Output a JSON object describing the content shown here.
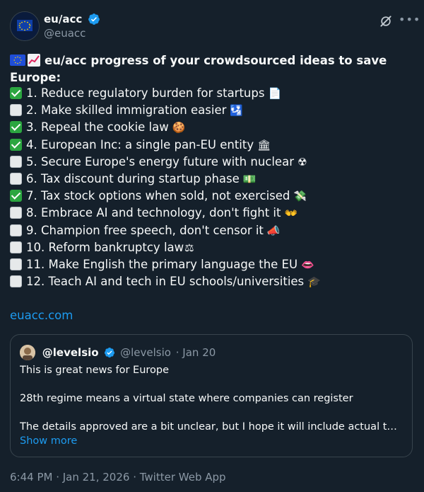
{
  "author": {
    "display_name": "eu/acc",
    "handle": "@euacc",
    "verified": true
  },
  "headline": "eu/acc progress of your crowdsourced ideas to save Europe:",
  "items": [
    {
      "text": "1. Reduce regulatory burden for startups",
      "done": true,
      "emoji": "📄"
    },
    {
      "text": "2. Make skilled immigration easier",
      "done": false,
      "emoji": "🛂"
    },
    {
      "text": "3. Repeal the cookie law",
      "done": true,
      "emoji": "🍪"
    },
    {
      "text": "4. European Inc: a single pan-EU entity",
      "done": true,
      "emoji": "🏛"
    },
    {
      "text": "5. Secure Europe's energy future with nuclear",
      "done": false,
      "emoji": "☢"
    },
    {
      "text": "6. Tax discount during startup phase",
      "done": false,
      "emoji": "💵"
    },
    {
      "text": "7. Tax stock options when sold, not exercised",
      "done": true,
      "emoji": "💸"
    },
    {
      "text": "8. Embrace AI and technology, don't fight it",
      "done": false,
      "emoji": "👐"
    },
    {
      "text": "9. Champion free speech, don't censor it",
      "done": false,
      "emoji": "📣"
    },
    {
      "text": "10. Reform bankruptcy law",
      "done": false,
      "emoji": "⚖"
    },
    {
      "text": "11. Make English the primary language the EU",
      "done": false,
      "emoji": "👄"
    },
    {
      "text": "12. Teach AI and tech in EU schools/universities",
      "done": false,
      "emoji": "🎓"
    }
  ],
  "link": "euacc.com",
  "quote": {
    "display_name": "@levelsio",
    "handle": "@levelsio",
    "date": "· Jan 20",
    "lines": [
      "This is great news for Europe",
      "",
      "28th regime means a virtual state where companies can register",
      "",
      "The details approved are a bit unclear, but I hope it will include actual taxes ..."
    ],
    "show_more": "Show more"
  },
  "footer": "6:44 PM · Jan 21, 2026 · Twitter Web App",
  "colors": {
    "background": "#15202b",
    "text": "#f7f9f9",
    "muted": "#8b98a5",
    "link": "#1d9bf0",
    "check_green": "#2ba640",
    "border": "#38444d"
  },
  "icons": {
    "grok": "grok-icon",
    "more": "more-icon",
    "verified": "verified-badge-icon"
  }
}
